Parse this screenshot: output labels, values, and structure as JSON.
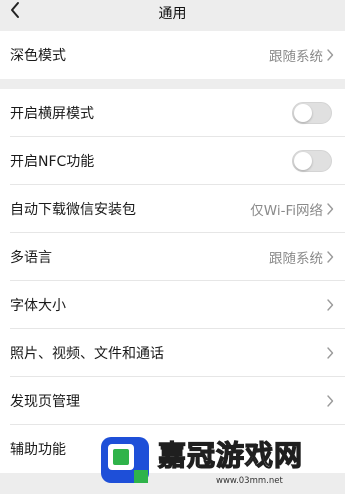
{
  "header": {
    "title": "通用"
  },
  "settings": {
    "dark_mode": {
      "label": "深色模式",
      "value": "跟随系统"
    },
    "landscape": {
      "label": "开启横屏模式",
      "enabled": false
    },
    "nfc": {
      "label": "开启NFC功能",
      "enabled": false
    },
    "auto_download": {
      "label": "自动下载微信安装包",
      "value": "仅Wi-Fi网络"
    },
    "language": {
      "label": "多语言",
      "value": "跟随系统"
    },
    "font_size": {
      "label": "字体大小"
    },
    "media": {
      "label": "照片、视频、文件和通话"
    },
    "discover": {
      "label": "发现页管理"
    },
    "accessibility": {
      "label": "辅助功能"
    }
  },
  "watermark": {
    "text": "嘉冠游戏网",
    "url": "www.03mm.net"
  },
  "colors": {
    "background": "#ededed",
    "row_background": "#ffffff",
    "value_text": "#8a8a8a",
    "toggle_off": "#e0e0e0",
    "watermark_blue": "#1e4fd8",
    "watermark_green": "#2fb34a"
  },
  "icons": {
    "back": "chevron-left-icon",
    "row_arrow": "chevron-right-icon",
    "toggle": "toggle-switch"
  }
}
